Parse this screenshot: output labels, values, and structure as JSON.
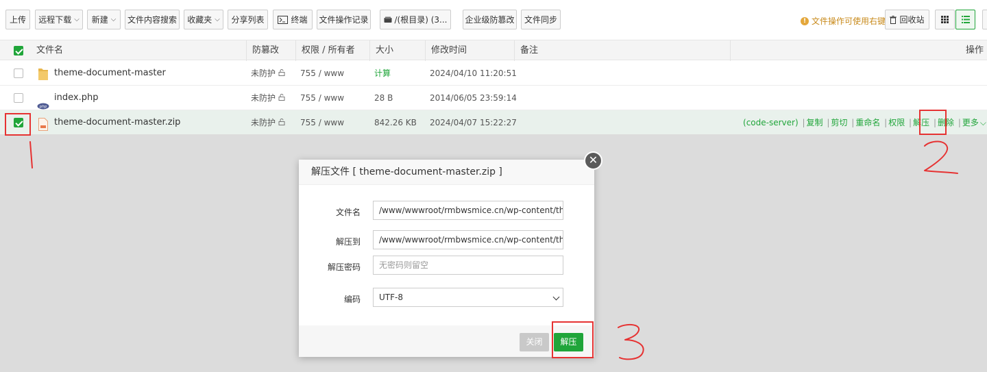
{
  "toolbar": {
    "upload": "上传",
    "remote_download": "远程下载",
    "new": "新建",
    "content_search": "文件内容搜索",
    "favorites": "收藏夹",
    "share_list": "分享列表",
    "terminal": "终端",
    "file_ops_log": "文件操作记录",
    "root_dir": "/(根目录) (3...",
    "enterprise_tamper": "企业级防篡改",
    "file_sync": "文件同步",
    "hint": "文件操作可使用右键",
    "recycle_bin": "回收站"
  },
  "table": {
    "columns": {
      "name": "文件名",
      "tamper": "防篡改",
      "perm": "权限 / 所有者",
      "size": "大小",
      "mtime": "修改时间",
      "note": "备注",
      "ops": "操作"
    },
    "rows": [
      {
        "name": "theme-document-master",
        "tamper": "未防护",
        "perm": "755 / www",
        "size": "计算",
        "mtime": "2024/04/10 11:20:51",
        "icon": "folder-icon"
      },
      {
        "name": "index.php",
        "tamper": "未防护",
        "perm": "755 / www",
        "size": "28 B",
        "mtime": "2014/06/05 23:59:14",
        "icon": "php-file-icon"
      },
      {
        "name": "theme-document-master.zip",
        "tamper": "未防护",
        "perm": "755 / www",
        "size": "842.26 KB",
        "mtime": "2024/04/07 15:22:27",
        "icon": "zip-file-icon",
        "selected": true
      }
    ],
    "row_ops": {
      "code_server": "(code-server)",
      "copy": "复制",
      "cut": "剪切",
      "rename": "重命名",
      "perm": "权限",
      "extract": "解压",
      "delete": "删除",
      "more": "更多"
    }
  },
  "modal": {
    "title": "解压文件 [ theme-document-master.zip ]",
    "file_label": "文件名",
    "file_value": "/www/wwwroot/rmbwsmice.cn/wp-content/themes/",
    "dest_label": "解压到",
    "dest_value": "/www/wwwroot/rmbwsmice.cn/wp-content/themes",
    "pwd_label": "解压密码",
    "pwd_placeholder": "无密码则留空",
    "enc_label": "编码",
    "enc_value": "UTF-8",
    "close_btn": "关闭",
    "extract_btn": "解压"
  },
  "colors": {
    "accent": "#20a53a",
    "annotation": "#e63232",
    "hint": "#c88a1b"
  }
}
